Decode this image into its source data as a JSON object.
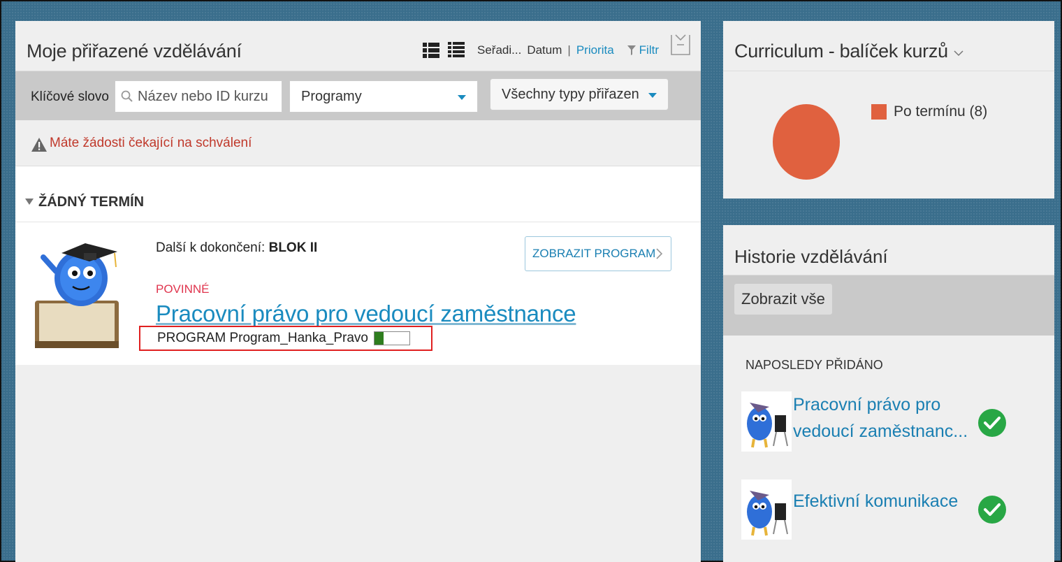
{
  "assigned": {
    "title": "Moje přiřazené vzdělávání",
    "sort_label": "Seřadi...",
    "sort_date": "Datum",
    "sort_separator": "|",
    "sort_priority": "Priorita",
    "filter_label": "Filtr",
    "keyword_label": "Klíčové slovo",
    "search_placeholder": "Název nebo ID kurzu",
    "programs_select": "Programy",
    "types_select": "Všechny typy přiřazen",
    "warning": "Máte žádosti čekající na schválení",
    "group_title": "ŽÁDNÝ TERMÍN",
    "item": {
      "next_label": "Další k dokončení:",
      "next_value": "BLOK II",
      "show_button": "ZOBRAZIT PROGRAM",
      "required": "POVINNÉ",
      "course_title": "Pracovní právo pro vedoucí zaměstnance",
      "program_line": "PROGRAM Program_Hanka_Pravo",
      "progress_fraction": 0.25
    }
  },
  "curriculum": {
    "title": "Curriculum - balíček kurzů",
    "legend_label": "Po termínu (8)",
    "color": "#e0613f"
  },
  "history": {
    "title": "Historie vzdělávání",
    "show_all": "Zobrazit vše",
    "recent_label": "NAPOSLEDY PŘIDÁNO",
    "items": [
      {
        "line1": "Pracovní právo pro",
        "line2": "vedoucí zaměstnanc..."
      },
      {
        "line1": "Efektivní komunikace",
        "line2": ""
      }
    ]
  },
  "colors": {
    "accent": "#1a8bbf",
    "required": "#e0354e",
    "warning": "#c0392b",
    "success": "#28a745",
    "highlight_border": "#e02020"
  }
}
